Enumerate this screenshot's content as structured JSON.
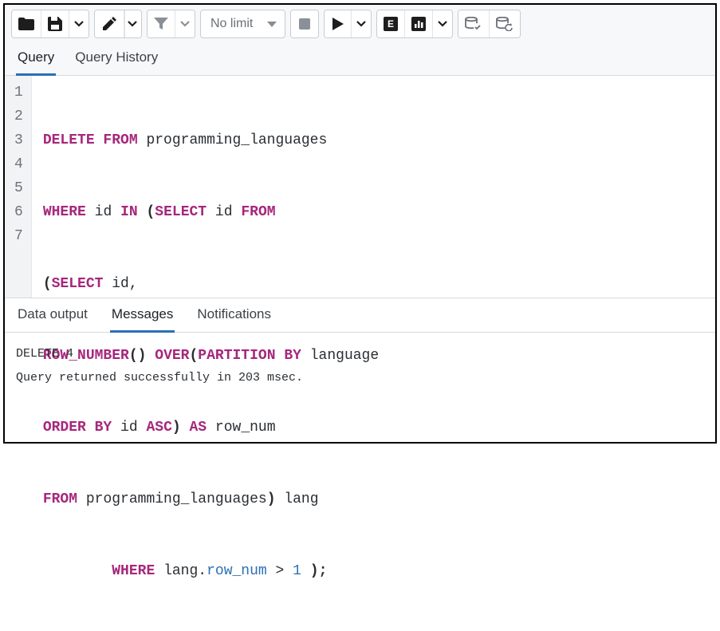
{
  "toolbar": {
    "limit_label": "No limit"
  },
  "editor_tabs": {
    "query": "Query",
    "history": "Query History"
  },
  "code_lines": {
    "l1": {
      "kw1": "DELETE FROM",
      "id1": "programming_languages"
    },
    "l2": {
      "kw1": "WHERE",
      "id1": "id",
      "kw2": "IN",
      "p1": "(",
      "kw3": "SELECT",
      "id2": "id",
      "kw4": "FROM"
    },
    "l3": {
      "p1": "(",
      "kw1": "SELECT",
      "id1": "id",
      "comma": ","
    },
    "l4": {
      "kw1": "ROW_NUMBER",
      "p1": "()",
      "kw2": "OVER",
      "p2": "(",
      "kw3": "PARTITION BY",
      "id1": "language"
    },
    "l5": {
      "kw1": "ORDER BY",
      "id1": "id",
      "kw2": "ASC",
      "p1": ")",
      "kw3": "AS",
      "id2": "row_num"
    },
    "l6": {
      "kw1": "FROM",
      "id1": "programming_languages",
      "p1": ")",
      "id2": "lang"
    },
    "l7": {
      "kw1": "WHERE",
      "id1": "lang",
      "dot": ".",
      "fld1": "row_num",
      "op": ">",
      "num": "1",
      "p1": ");"
    }
  },
  "line_numbers": [
    "1",
    "2",
    "3",
    "4",
    "5",
    "6",
    "7"
  ],
  "output_tabs": {
    "data": "Data output",
    "messages": "Messages",
    "notifications": "Notifications"
  },
  "messages": {
    "line1": "DELETE 4",
    "line2": "Query returned successfully in 203 msec."
  }
}
